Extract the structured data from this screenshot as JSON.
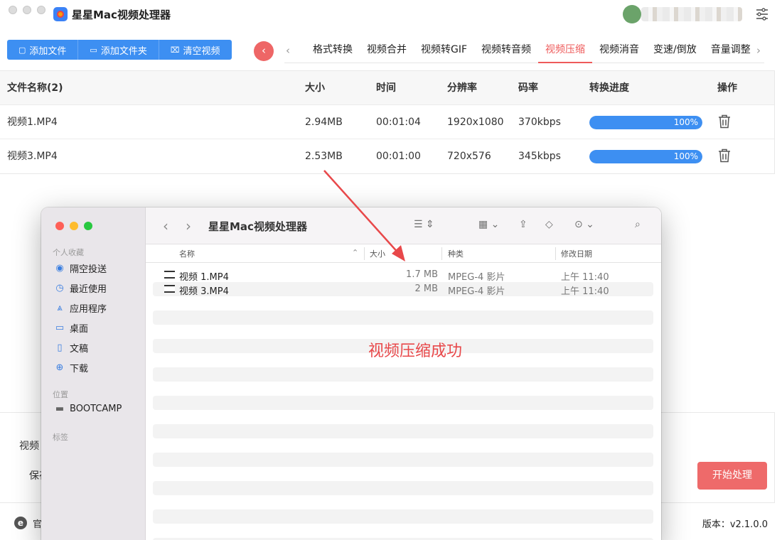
{
  "app": {
    "title": "星星Mac视频处理器",
    "settings_icon": "sliders-icon"
  },
  "toolbar": {
    "add_file": "添加文件",
    "add_folder": "添加文件夹",
    "clear": "清空视频"
  },
  "tabs": [
    {
      "label": "格式转换",
      "active": false
    },
    {
      "label": "视频合并",
      "active": false
    },
    {
      "label": "视频转GIF",
      "active": false
    },
    {
      "label": "视频转音频",
      "active": false
    },
    {
      "label": "视频压缩",
      "active": true
    },
    {
      "label": "视频消音",
      "active": false
    },
    {
      "label": "变速/倒放",
      "active": false
    },
    {
      "label": "音量调整",
      "active": false
    }
  ],
  "table": {
    "headers": {
      "name": "文件名称(2)",
      "size": "大小",
      "time": "时间",
      "resolution": "分辨率",
      "bitrate": "码率",
      "progress": "转换进度",
      "action": "操作"
    },
    "rows": [
      {
        "name": "视频1.MP4",
        "size": "2.94MB",
        "time": "00:01:04",
        "resolution": "1920x1080",
        "bitrate": "370kbps",
        "progress": 1.0,
        "progress_text": "100%"
      },
      {
        "name": "视频3.MP4",
        "size": "2.53MB",
        "time": "00:01:00",
        "resolution": "720x576",
        "bitrate": "345kbps",
        "progress": 1.0,
        "progress_text": "100%"
      }
    ]
  },
  "bottom": {
    "label1": "视频",
    "label2": "保存",
    "start_button": "开始处理",
    "site_text": "官",
    "version": "版本：v2.1.0.0"
  },
  "finder": {
    "title": "星星Mac视频处理器",
    "sidebar": {
      "favorites_label": "个人收藏",
      "favorites": [
        {
          "label": "隔空投送",
          "icon": "airdrop-icon"
        },
        {
          "label": "最近使用",
          "icon": "clock-icon"
        },
        {
          "label": "应用程序",
          "icon": "applications-icon"
        },
        {
          "label": "桌面",
          "icon": "desktop-icon"
        },
        {
          "label": "文稿",
          "icon": "document-icon"
        },
        {
          "label": "下载",
          "icon": "download-icon"
        }
      ],
      "locations_label": "位置",
      "locations": [
        {
          "label": "BOOTCAMP",
          "icon": "disk-icon"
        }
      ],
      "tags_label": "标签"
    },
    "columns": {
      "name": "名称",
      "size": "大小",
      "kind": "种类",
      "date": "修改日期"
    },
    "files": [
      {
        "name": "视频 1.MP4",
        "size": "1.7 MB",
        "kind": "MPEG-4 影片",
        "date": "上午 11:40"
      },
      {
        "name": "视频 3.MP4",
        "size": "2 MB",
        "kind": "MPEG-4 影片",
        "date": "上午 11:40"
      }
    ],
    "success_text": "视频压缩成功"
  },
  "colors": {
    "accent_blue": "#3d8ff2",
    "accent_red": "#ee5a5a",
    "annotation_red": "#e8484a"
  }
}
